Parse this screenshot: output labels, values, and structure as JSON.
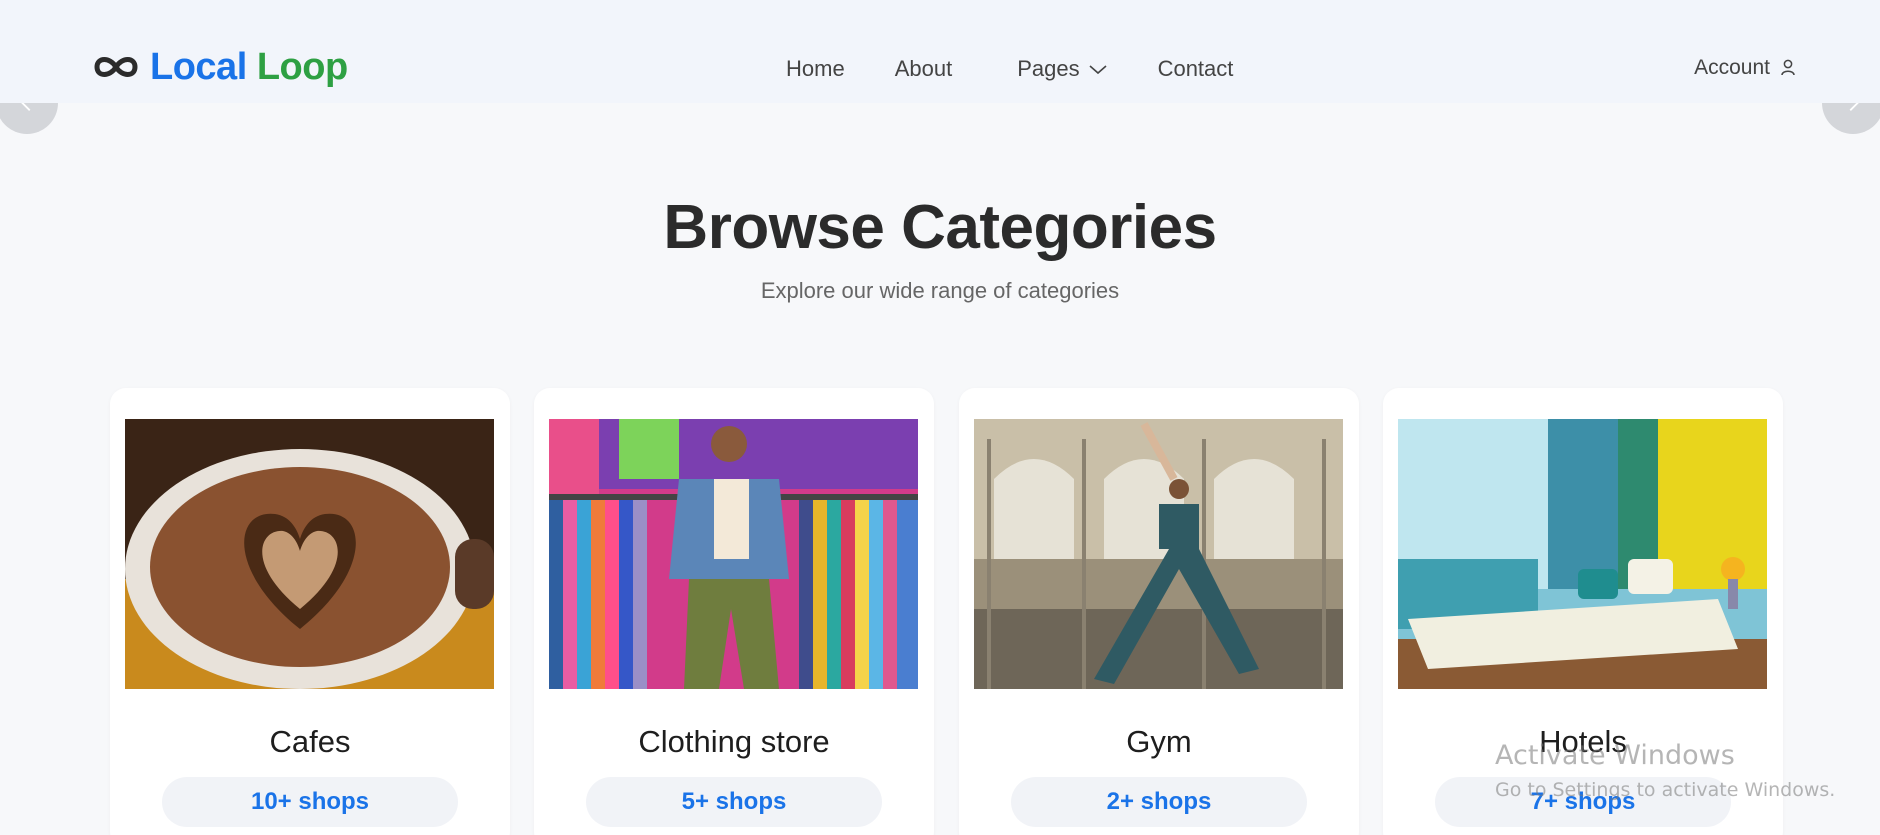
{
  "brand": {
    "name_part1": "Local",
    "name_part2": "Loop",
    "icon": "infinity-icon"
  },
  "nav": {
    "home": "Home",
    "about": "About",
    "pages": "Pages",
    "contact": "Contact"
  },
  "account": {
    "label": "Account",
    "icon": "user-icon"
  },
  "section": {
    "title": "Browse Categories",
    "subtitle": "Explore our wide range of categories"
  },
  "categories": [
    {
      "name": "Cafes",
      "shops": "10+ shops",
      "image": "coffee-latte-art-image"
    },
    {
      "name": "Clothing store",
      "shops": "5+ shops",
      "image": "clothing-store-image"
    },
    {
      "name": "Gym",
      "shops": "2+ shops",
      "image": "yoga-gym-image"
    },
    {
      "name": "Hotels",
      "shops": "7+ shops",
      "image": "hotel-room-image"
    }
  ],
  "watermark": {
    "title": "Activate Windows",
    "subtitle": "Go to Settings to activate Windows."
  },
  "colors": {
    "brand_blue": "#1a73e8",
    "brand_green": "#2ea043",
    "header_bg": "#f2f5fb",
    "page_bg": "#f7f8fa"
  }
}
